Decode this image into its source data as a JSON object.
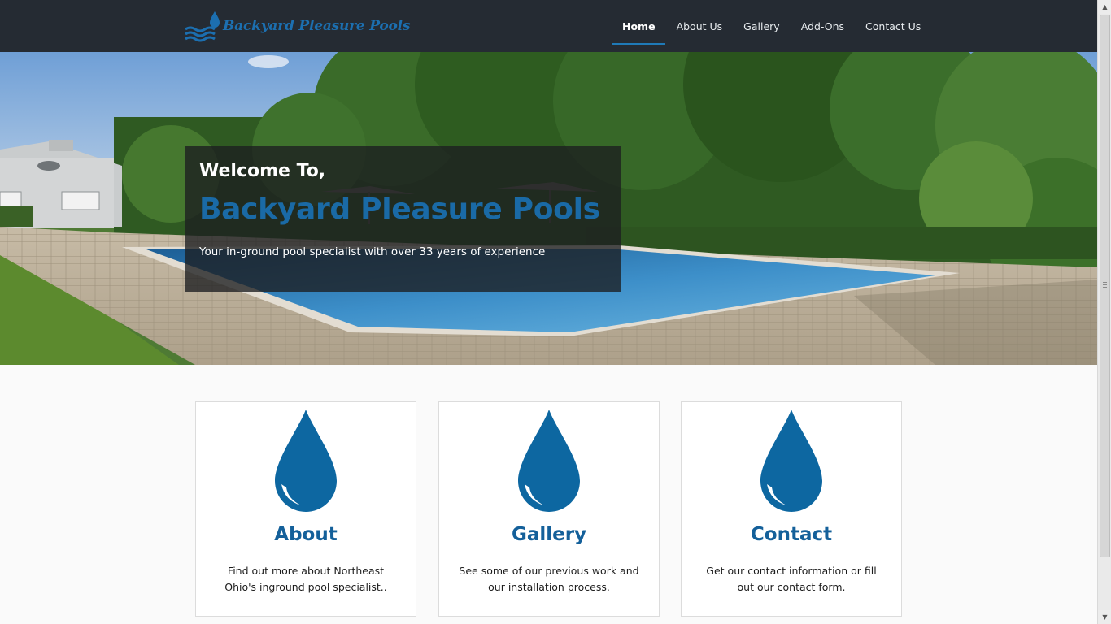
{
  "header": {
    "logo_text": "Backyard Pleasure Pools",
    "nav": [
      {
        "label": "Home",
        "active": true
      },
      {
        "label": "About Us"
      },
      {
        "label": "Gallery"
      },
      {
        "label": "Add-Ons"
      },
      {
        "label": "Contact Us"
      }
    ]
  },
  "hero": {
    "welcome": "Welcome To,",
    "brand": "Backyard Pleasure Pools",
    "tagline": "Your in-ground pool specialist with over 33 years of experience"
  },
  "cards": [
    {
      "icon": "water-drop-icon",
      "title": "About",
      "text": "Find out more about Northeast Ohio's inground pool specialist.."
    },
    {
      "icon": "water-drop-icon",
      "title": "Gallery",
      "text": "See some of our previous work and our installation process."
    },
    {
      "icon": "water-drop-icon",
      "title": "Contact",
      "text": "Get our contact information or fill out our contact form."
    }
  ],
  "colors": {
    "brand_blue": "#14609a",
    "header_bg": "#252b33",
    "nav_active_underline": "#1f7ab8",
    "drop_blue": "#0d67a1"
  }
}
